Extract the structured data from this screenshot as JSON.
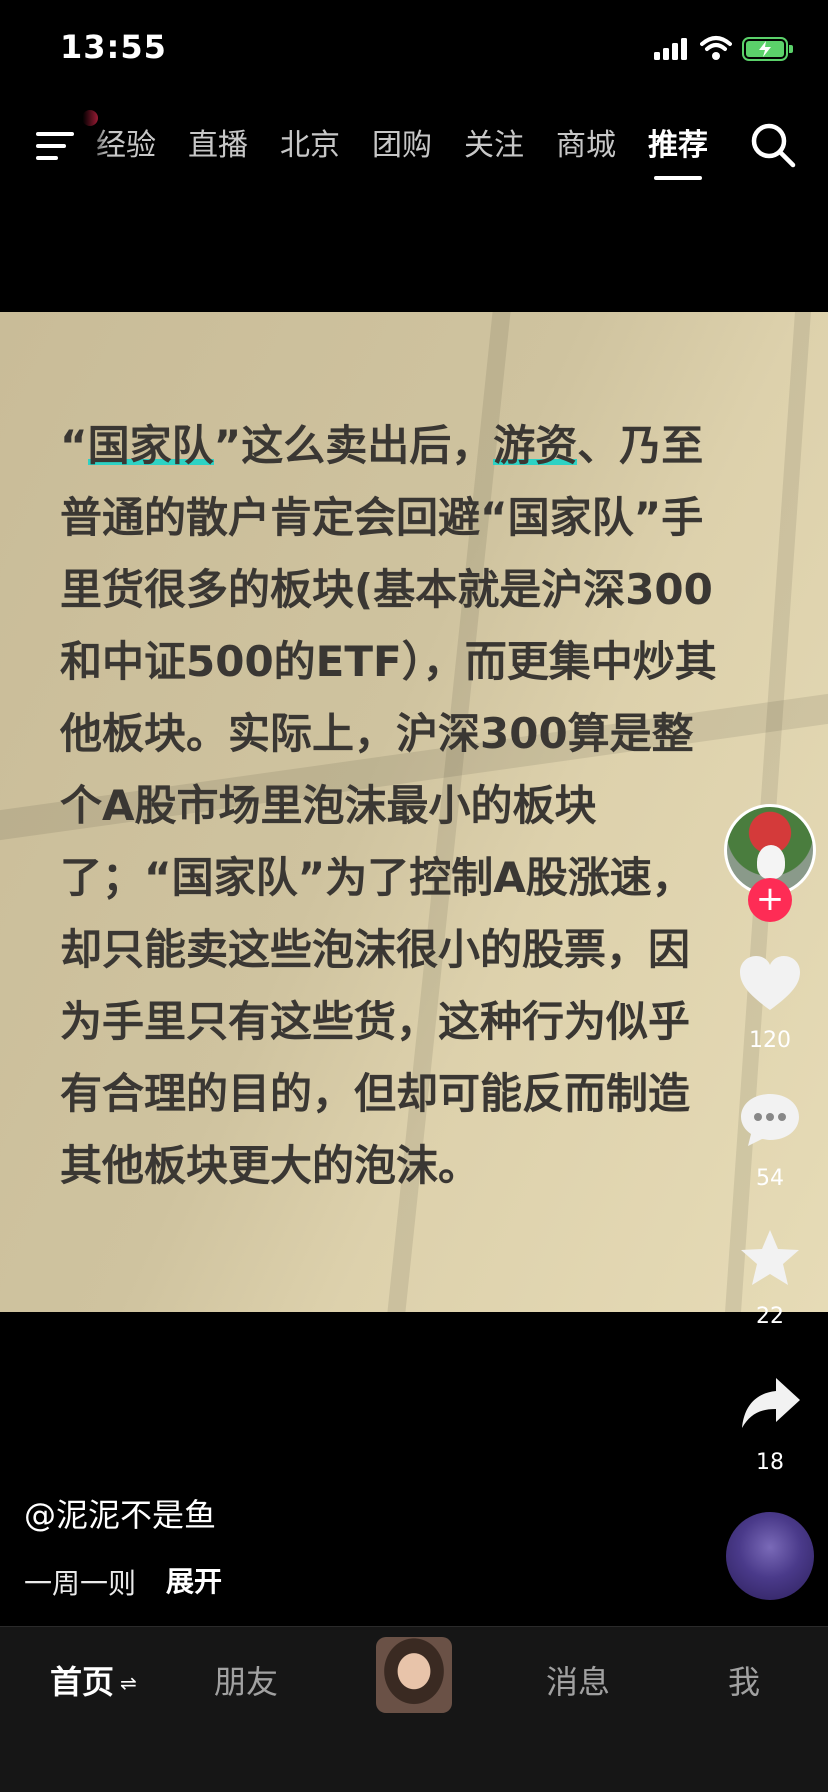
{
  "status_bar": {
    "time": "13:55",
    "battery_color": "#5bd16a"
  },
  "top_nav": {
    "tabs": [
      {
        "label": "经验"
      },
      {
        "label": "直播"
      },
      {
        "label": "北京"
      },
      {
        "label": "团购"
      },
      {
        "label": "关注"
      },
      {
        "label": "商城"
      },
      {
        "label": "推荐"
      }
    ],
    "active_tab": "推荐",
    "badge_color": "#fe2c55"
  },
  "post": {
    "seg1": "“",
    "hl1": "国家队",
    "seg2": "”这么卖出后，",
    "hl2": "游资",
    "seg3": "、乃至普通的散户肯定会回避“国家队”手里货很多的板块(基本就是沪深300和中证500的ETF），而更集中炒其他板块。实际上，沪深300算是整个A股市场里泡沫最小的板块了；“国家队”为了控制A股涨速，却只能卖这些泡沫很小的股票，因为手里只有这些货，这种行为似乎有合理的目的，但却可能反而制造其他板块更大的泡沫。",
    "highlight_color": "#2dd2c4"
  },
  "actions": {
    "likes": "120",
    "comments": "54",
    "favorites": "22",
    "shares": "18",
    "follow_symbol": "+"
  },
  "caption": {
    "author": "@泥泥不是鱼",
    "description": "一周一则",
    "expand": "展开"
  },
  "tab_bar": {
    "home": "首页",
    "home_switch": "⇌",
    "friends": "朋友",
    "messages": "消息",
    "me": "我"
  }
}
